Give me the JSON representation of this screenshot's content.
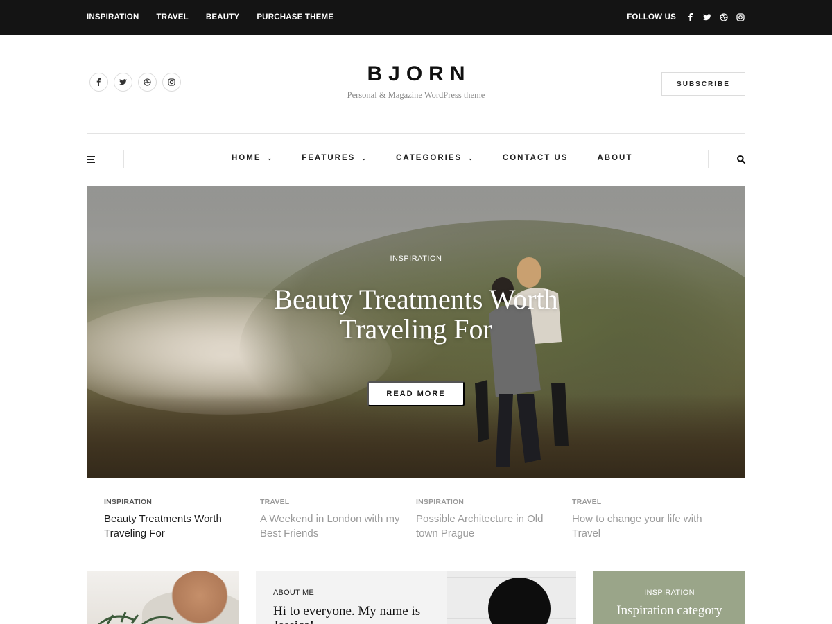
{
  "topbar": {
    "nav": [
      "INSPIRATION",
      "TRAVEL",
      "BEAUTY",
      "PURCHASE THEME"
    ],
    "follow_label": "FOLLOW US",
    "icons": [
      "facebook-icon",
      "twitter-icon",
      "dribbble-icon",
      "instagram-icon"
    ]
  },
  "header": {
    "title": "BJORN",
    "tagline": "Personal & Magazine WordPress theme",
    "subscribe_label": "SUBSCRIBE",
    "social_icons": [
      "facebook-icon",
      "twitter-icon",
      "dribbble-icon",
      "instagram-icon"
    ]
  },
  "mainnav": {
    "items": [
      {
        "label": "HOME",
        "has_dropdown": true
      },
      {
        "label": "FEATURES",
        "has_dropdown": true
      },
      {
        "label": "CATEGORIES",
        "has_dropdown": true
      },
      {
        "label": "CONTACT US",
        "has_dropdown": false
      },
      {
        "label": "ABOUT",
        "has_dropdown": false
      }
    ],
    "dropdown_glyph": "⌄"
  },
  "hero": {
    "category": "INSPIRATION",
    "title": "Beauty Treatments Worth Traveling For",
    "button_label": "READ MORE"
  },
  "posts": [
    {
      "category": "INSPIRATION",
      "title": "Beauty Treatments Worth Traveling For",
      "active": true
    },
    {
      "category": "TRAVEL",
      "title": "A Weekend in London with my Best Friends",
      "active": false
    },
    {
      "category": "INSPIRATION",
      "title": "Possible Architecture in Old town Prague",
      "active": false
    },
    {
      "category": "TRAVEL",
      "title": "How to change your life with Travel",
      "active": false
    }
  ],
  "cards": {
    "about": {
      "label": "ABOUT ME",
      "text": "Hi to everyone. My name is Jessica!"
    },
    "category": {
      "label": "INSPIRATION",
      "title": "Inspiration category"
    }
  },
  "colors": {
    "topbar_bg": "#141414",
    "category_card_bg": "#9aa589"
  }
}
